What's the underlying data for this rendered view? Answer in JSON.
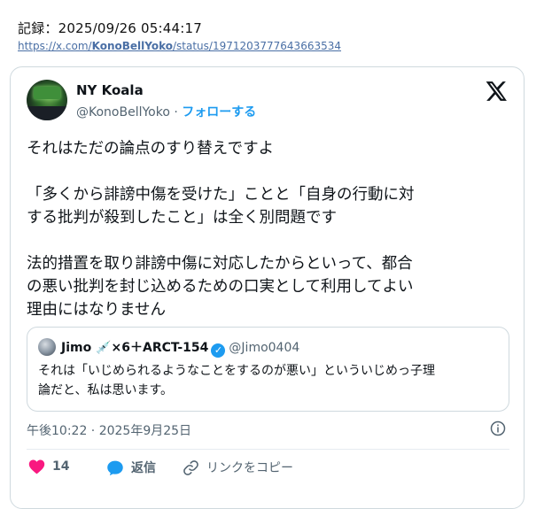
{
  "record": {
    "label": "記録：2025/09/26 05:44:17"
  },
  "source_url": {
    "prefix": "https://x.com/",
    "user": "KonoBellYoko",
    "suffix": "/status/1971203777643663534"
  },
  "tweet": {
    "author_name": "NY Koala",
    "handle": "@KonoBellYoko",
    "separator": "·",
    "follow_label": "フォローする",
    "paragraphs": [
      [
        "それはただの論点のすり替えですよ"
      ],
      [
        "「多くから誹謗中傷を受けた」ことと「自身の行動に対",
        "する批判が殺到したこと」は全く別問題です"
      ],
      [
        "法的措置を取り誹謗中傷に対応したからといって、都合",
        "の悪い批判を封じ込めるための口実として利用してよい",
        "理由にはなりません"
      ]
    ],
    "timestamp": "午後10:22 · 2025年9月25日"
  },
  "quote": {
    "name": "Jimo 💉×6＋ARCT-154",
    "verified_mark": "✓",
    "handle": "@Jimo0404",
    "lines": [
      "それは「いじめられるようなことをするのが悪い」といういじめっ子理",
      "論だと、私は思います。"
    ]
  },
  "actions": {
    "like_count": "14",
    "reply_label": "返信",
    "copy_link_label": "リンクをコピー"
  },
  "colors": {
    "accent": "#1d9bf0",
    "like": "#f91880",
    "muted": "#536471",
    "url": "#4a6fa5"
  },
  "icons": [
    "x-logo-icon",
    "info-icon",
    "heart-icon",
    "reply-icon",
    "link-icon",
    "verified-badge-icon"
  ]
}
